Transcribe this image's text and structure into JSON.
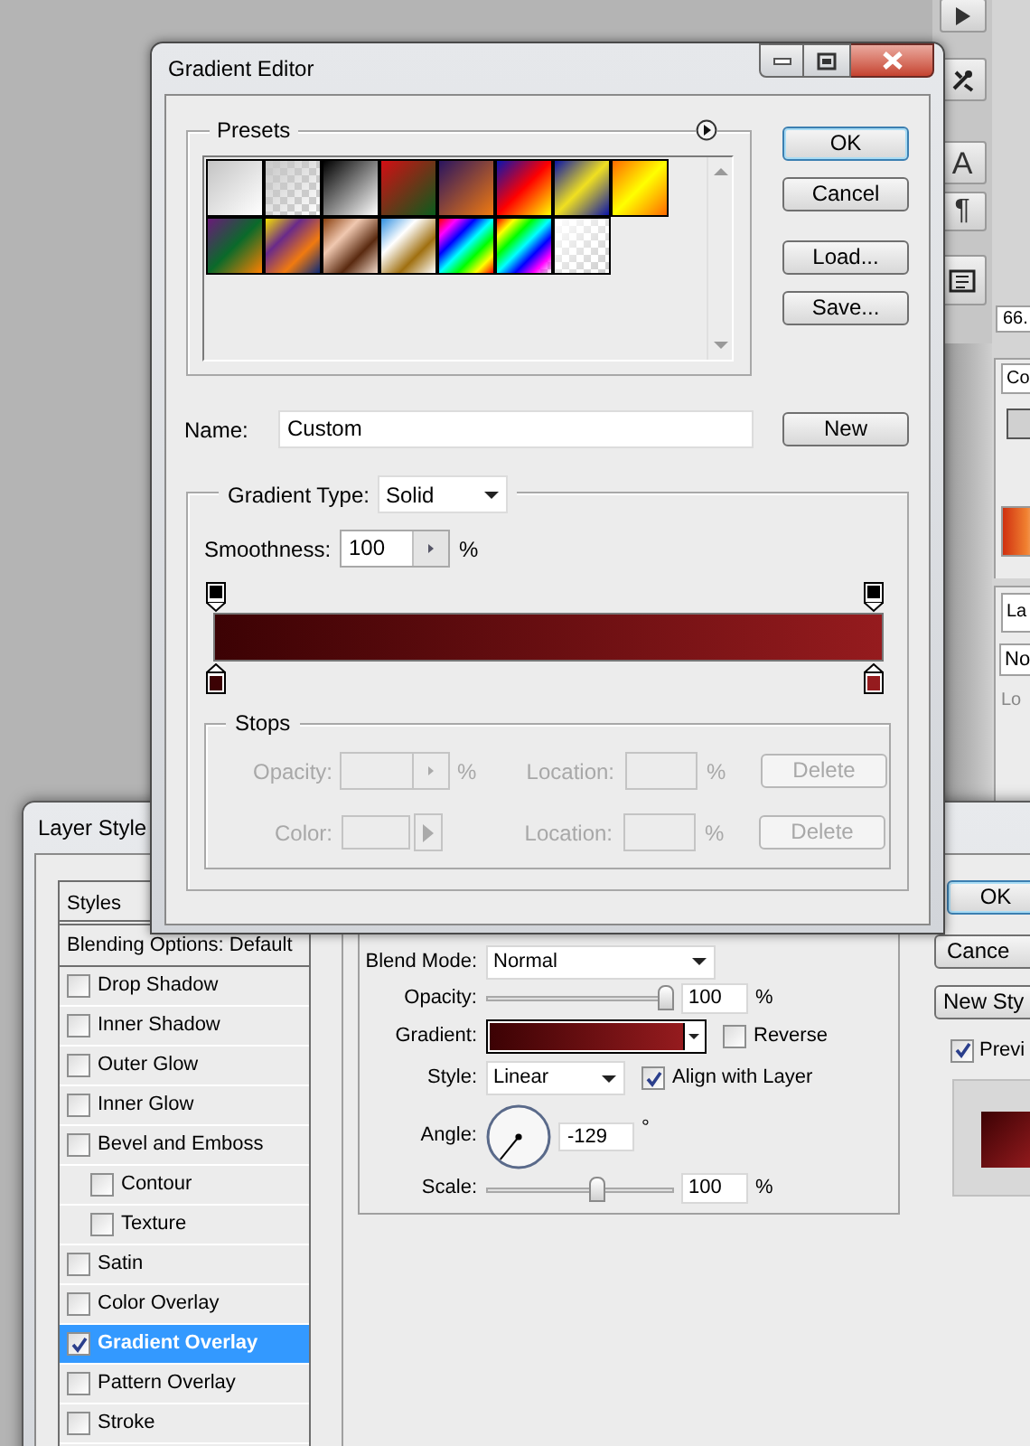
{
  "desktop_panel": {
    "toolbar_glyphs": [
      "A",
      "¶"
    ],
    "zoom_field": "66.",
    "tabs": [
      "Co",
      "La"
    ],
    "blend_dropdown": "No",
    "lock_label": "Lo"
  },
  "gradient_editor": {
    "title": "Gradient Editor",
    "presets": {
      "label": "Presets"
    },
    "buttons": [
      {
        "label": "OK",
        "default": true
      },
      {
        "label": "Cancel",
        "default": false
      },
      {
        "label": "Load...",
        "default": false
      },
      {
        "label": "Save...",
        "default": false
      }
    ],
    "name": {
      "label": "Name:",
      "value": "Custom"
    },
    "new_button": "New",
    "gradient_type": {
      "label": "Gradient Type:",
      "value": "Solid"
    },
    "smoothness": {
      "label": "Smoothness:",
      "value": "100",
      "unit": "%"
    },
    "opacity_stops": [
      {
        "selected": false
      },
      {
        "selected": false
      }
    ],
    "color_stops": [
      {
        "color": "#3c0204",
        "selected": false
      },
      {
        "color": "#951b1e",
        "selected": false
      }
    ],
    "stops": {
      "label": "Stops",
      "rows": [
        {
          "kind": "opacity",
          "label": "Opacity:",
          "unit": "%",
          "location_label": "Location:",
          "location_unit": "%",
          "button": "Delete",
          "disabled": true
        },
        {
          "kind": "color",
          "label": "Color:",
          "location_label": "Location:",
          "location_unit": "%",
          "button": "Delete",
          "disabled": true
        }
      ]
    }
  },
  "layer_style": {
    "title": "Layer Style",
    "styles_header": "Styles",
    "blending_options": "Blending Options: Default",
    "effects": [
      {
        "label": "Drop Shadow",
        "checked": false,
        "selected": false
      },
      {
        "label": "Inner Shadow",
        "checked": false,
        "selected": false
      },
      {
        "label": "Outer Glow",
        "checked": false,
        "selected": false
      },
      {
        "label": "Inner Glow",
        "checked": false,
        "selected": false
      },
      {
        "label": "Bevel and Emboss",
        "checked": false,
        "selected": false,
        "children": [
          {
            "label": "Contour",
            "checked": false,
            "selected": false
          },
          {
            "label": "Texture",
            "checked": false,
            "selected": false
          }
        ]
      },
      {
        "label": "Satin",
        "checked": false,
        "selected": false
      },
      {
        "label": "Color Overlay",
        "checked": false,
        "selected": false
      },
      {
        "label": "Gradient Overlay",
        "checked": true,
        "selected": true
      },
      {
        "label": "Pattern Overlay",
        "checked": false,
        "selected": false
      },
      {
        "label": "Stroke",
        "checked": false,
        "selected": false
      }
    ],
    "gradient_overlay": {
      "blend_mode": {
        "label": "Blend Mode:",
        "value": "Normal"
      },
      "opacity": {
        "label": "Opacity:",
        "level": 1,
        "value": "100",
        "unit": "%"
      },
      "gradient": {
        "label": "Gradient:"
      },
      "reverse": {
        "label": "Reverse",
        "checked": false
      },
      "style": {
        "label": "Style:",
        "value": "Linear"
      },
      "align_with_layer": {
        "label": "Align with Layer",
        "checked": true
      },
      "angle": {
        "label": "Angle:",
        "value": "-129",
        "unit": "°"
      },
      "scale": {
        "label": "Scale:",
        "level": 0.6,
        "value": "100",
        "unit": "%"
      }
    },
    "buttons": [
      {
        "label": "OK",
        "default": true
      },
      {
        "label": "Cance",
        "default": false
      },
      {
        "label": "New Sty",
        "default": false
      }
    ],
    "preview": {
      "label": "Previ",
      "checked": true
    }
  }
}
